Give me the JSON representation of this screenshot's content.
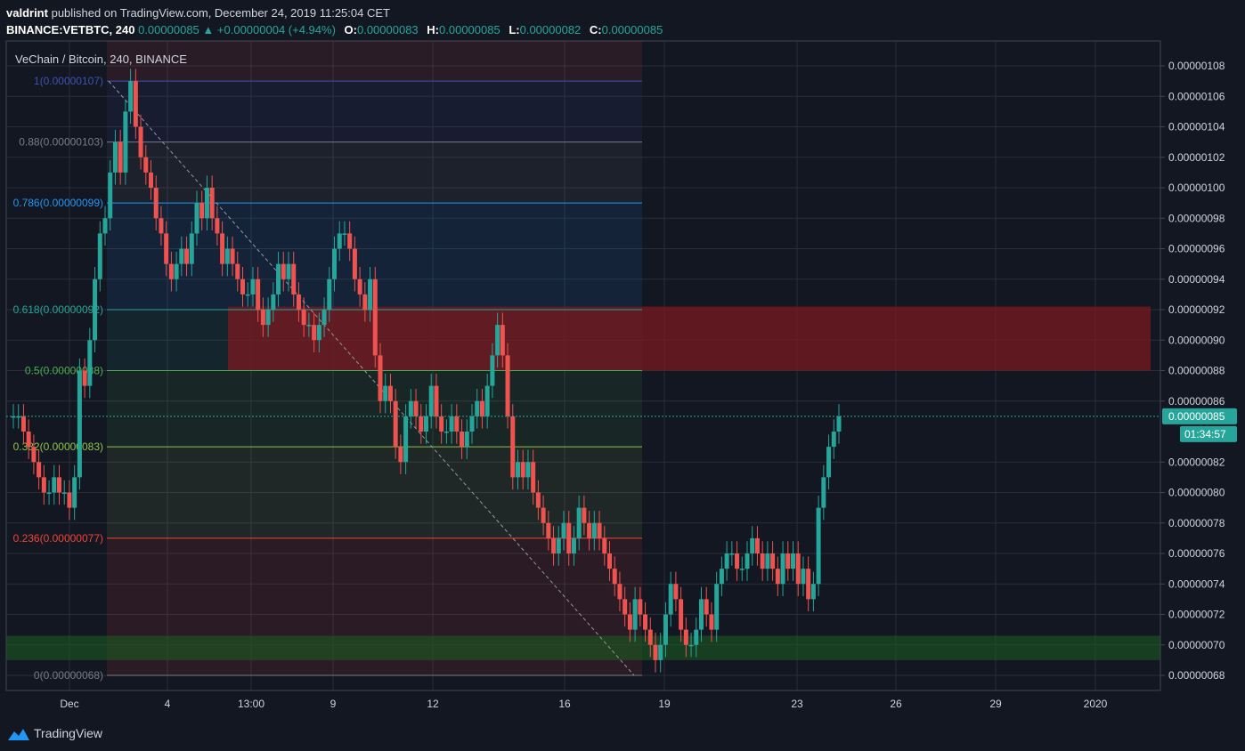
{
  "header": {
    "publisher": "valdrint",
    "published_text": "published on TradingView.com, December 24, 2019 11:25:04 CET",
    "symbol": "BINANCE:VETBTC, 240",
    "last": "0.00000085",
    "change_arrow": "▲",
    "change": "+0.00000004 (+4.94%)",
    "o_label": "O:",
    "o_value": "0.00000083",
    "h_label": "H:",
    "h_value": "0.00000085",
    "l_label": "L:",
    "l_value": "0.00000082",
    "c_label": "C:",
    "c_value": "0.00000085"
  },
  "footer": {
    "brand": "TradingView",
    "logo_icon": "tradingview-logo-icon"
  },
  "colors": {
    "background": "#131722",
    "grid": "#2a2e39",
    "up": "#26a69a",
    "down": "#ef5350",
    "resistance_zone": "#7a1a1f",
    "support_zone": "#1b5e20"
  },
  "chart_data": {
    "type": "candlestick",
    "title": "VeChain / Bitcoin, 240, BINANCE",
    "x_tick_labels": [
      "Dec",
      "4",
      "13:00",
      "9",
      "12",
      "16",
      "19",
      "23",
      "26",
      "29",
      "2020"
    ],
    "y_tick_labels": [
      "0.00000108",
      "0.00000106",
      "0.00000104",
      "0.00000102",
      "0.00000100",
      "0.00000098",
      "0.00000096",
      "0.00000094",
      "0.00000092",
      "0.00000090",
      "0.00000088",
      "0.00000086",
      "0.00000082",
      "0.00000080",
      "0.00000078",
      "0.00000076",
      "0.00000074",
      "0.00000072",
      "0.00000070",
      "0.00000068"
    ],
    "ylim": [
      6.75e-07,
      1.088e-06
    ],
    "last_price_label": "0.00000085",
    "last_price": 8.5e-07,
    "countdown_label": "01:34:57",
    "fibonacci_levels": [
      {
        "label": "1(0.00000107)",
        "value": 1.07e-06,
        "color": "#3f51b5"
      },
      {
        "label": "0.88(0.00000103)",
        "value": 1.03e-06,
        "color": "#787b86"
      },
      {
        "label": "0.786(0.00000099)",
        "value": 9.9e-07,
        "color": "#2196f3"
      },
      {
        "label": "0.618(0.00000092)",
        "value": 9.2e-07,
        "color": "#26a69a"
      },
      {
        "label": "0.5(0.00000088)",
        "value": 8.8e-07,
        "color": "#4caf50"
      },
      {
        "label": "0.382(0.00000083)",
        "value": 8.3e-07,
        "color": "#8bc34a"
      },
      {
        "label": "0.236(0.00000077)",
        "value": 7.7e-07,
        "color": "#f44336"
      },
      {
        "label": "0(0.00000068)",
        "value": 6.8e-07,
        "color": "#787b86"
      }
    ],
    "resistance_zone": {
      "from": 8.8e-07,
      "to": 9.22e-07
    },
    "support_zone": {
      "from": 6.9e-07,
      "to": 7.06e-07
    },
    "trend_line": {
      "from": 1.07e-06,
      "to": 6.8e-07
    },
    "closes": [
      8.5e-07,
      8.5e-07,
      8.4e-07,
      8.3e-07,
      8.2e-07,
      8.1e-07,
      8e-07,
      8e-07,
      8.1e-07,
      8e-07,
      8e-07,
      7.9e-07,
      8.1e-07,
      8.8e-07,
      8.7e-07,
      9e-07,
      9.4e-07,
      9.7e-07,
      9.8e-07,
      1.01e-06,
      1.03e-06,
      1.01e-06,
      1.05e-06,
      1.07e-06,
      1.04e-06,
      1.02e-06,
      1.01e-06,
      1e-06,
      9.8e-07,
      9.7e-07,
      9.5e-07,
      9.4e-07,
      9.5e-07,
      9.6e-07,
      9.5e-07,
      9.7e-07,
      9.9e-07,
      9.8e-07,
      1e-06,
      9.8e-07,
      9.7e-07,
      9.5e-07,
      9.6e-07,
      9.5e-07,
      9.4e-07,
      9.3e-07,
      9.3e-07,
      9.4e-07,
      9.2e-07,
      9.1e-07,
      9.2e-07,
      9.3e-07,
      9.5e-07,
      9.4e-07,
      9.5e-07,
      9.3e-07,
      9.2e-07,
      9.1e-07,
      9.1e-07,
      9e-07,
      9.1e-07,
      9.2e-07,
      9.4e-07,
      9.6e-07,
      9.7e-07,
      9.7e-07,
      9.6e-07,
      9.4e-07,
      9.3e-07,
      9.2e-07,
      9.4e-07,
      8.9e-07,
      8.6e-07,
      8.7e-07,
      8.6e-07,
      8.3e-07,
      8.2e-07,
      8.5e-07,
      8.6e-07,
      8.5e-07,
      8.4e-07,
      8.5e-07,
      8.7e-07,
      8.5e-07,
      8.4e-07,
      8.4e-07,
      8.5e-07,
      8.4e-07,
      8.3e-07,
      8.4e-07,
      8.5e-07,
      8.6e-07,
      8.5e-07,
      8.7e-07,
      8.9e-07,
      9.1e-07,
      8.9e-07,
      8.5e-07,
      8.1e-07,
      8.2e-07,
      8.1e-07,
      8.2e-07,
      8e-07,
      7.9e-07,
      7.8e-07,
      7.7e-07,
      7.6e-07,
      7.7e-07,
      7.8e-07,
      7.6e-07,
      7.7e-07,
      7.9e-07,
      7.8e-07,
      7.7e-07,
      7.8e-07,
      7.7e-07,
      7.6e-07,
      7.5e-07,
      7.4e-07,
      7.3e-07,
      7.2e-07,
      7.1e-07,
      7.3e-07,
      7.2e-07,
      7.1e-07,
      7e-07,
      6.9e-07,
      7e-07,
      7.2e-07,
      7.4e-07,
      7.3e-07,
      7.1e-07,
      7e-07,
      7e-07,
      7.1e-07,
      7.3e-07,
      7.2e-07,
      7.1e-07,
      7.4e-07,
      7.5e-07,
      7.6e-07,
      7.6e-07,
      7.5e-07,
      7.5e-07,
      7.6e-07,
      7.7e-07,
      7.6e-07,
      7.5e-07,
      7.6e-07,
      7.5e-07,
      7.4e-07,
      7.6e-07,
      7.5e-07,
      7.6e-07,
      7.4e-07,
      7.5e-07,
      7.3e-07,
      7.4e-07,
      7.9e-07,
      8.1e-07,
      8.3e-07,
      8.4e-07,
      8.5e-07
    ]
  }
}
